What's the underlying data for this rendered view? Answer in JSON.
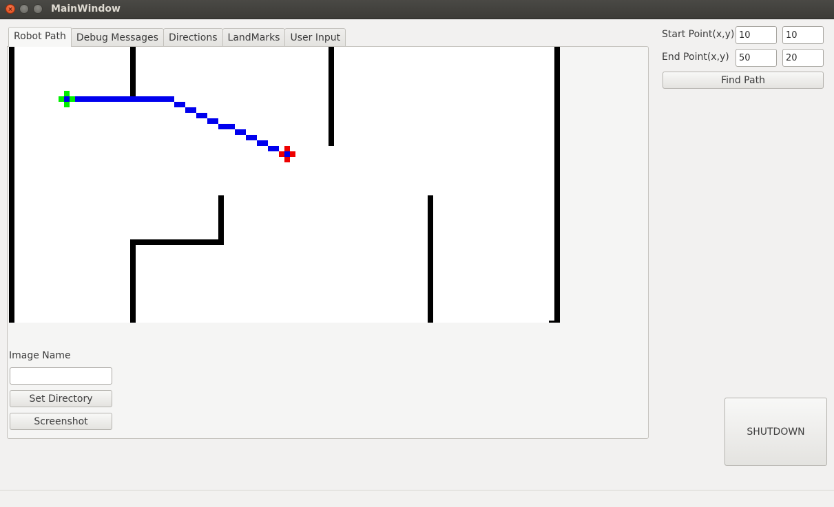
{
  "window": {
    "title": "MainWindow"
  },
  "tabs": [
    {
      "label": "Robot Path",
      "active": true
    },
    {
      "label": "Debug Messages",
      "active": false
    },
    {
      "label": "Directions",
      "active": false
    },
    {
      "label": "LandMarks",
      "active": false
    },
    {
      "label": "User Input",
      "active": false
    }
  ],
  "robot_path_tab": {
    "image_name_label": "Image Name",
    "image_name_value": "",
    "set_directory_label": "Set Directory",
    "screenshot_label": "Screenshot"
  },
  "map": {
    "colors": {
      "wall": "#000000",
      "path": "#0000ee",
      "start": "#00ee00",
      "end": "#ee0000"
    }
  },
  "controls": {
    "start_point_label": "Start Point(x,y)",
    "start_x": "10",
    "start_y": "10",
    "end_point_label": "End Point(x,y)",
    "end_x": "50",
    "end_y": "20",
    "find_path_label": "Find Path",
    "shutdown_label": "SHUTDOWN"
  }
}
